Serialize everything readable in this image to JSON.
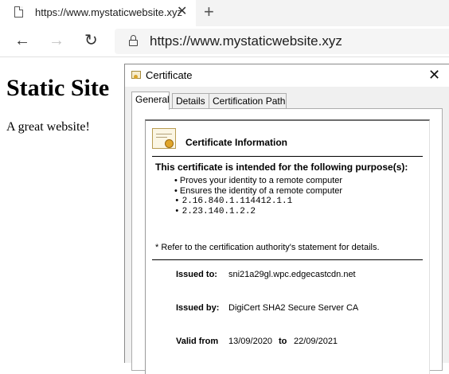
{
  "browser": {
    "tab_title": "https://www.mystaticwebsite.xyz",
    "tab_close": "✕",
    "new_tab": "+",
    "url": "https://www.mystaticwebsite.xyz",
    "icons": {
      "page": "page-icon",
      "back": "back-arrow-icon",
      "forward": "forward-arrow-icon",
      "refresh": "refresh-icon",
      "lock": "lock-icon"
    }
  },
  "page": {
    "heading": "Static Site",
    "paragraph": "A great website!"
  },
  "dialog": {
    "title": "Certificate",
    "close": "✕",
    "tabs": [
      "General",
      "Details",
      "Certification Path"
    ],
    "active_tab": "General",
    "info_title": "Certificate Information",
    "purpose_heading": "This certificate is intended for the following purpose(s):",
    "purposes": [
      "Proves your identity to a remote computer",
      "Ensures the identity of a remote computer",
      "2.16.840.1.114412.1.1",
      "2.23.140.1.2.2"
    ],
    "note": "* Refer to the certification authority's statement for details.",
    "issued_to_label": "Issued to:",
    "issued_to": "sni21a29gl.wpc.edgecastcdn.net",
    "issued_by_label": "Issued by:",
    "issued_by": "DigiCert SHA2 Secure Server CA",
    "valid_from_label": "Valid from",
    "valid_from": "13/09/2020",
    "valid_to_label": "to",
    "valid_to": "22/09/2021"
  }
}
